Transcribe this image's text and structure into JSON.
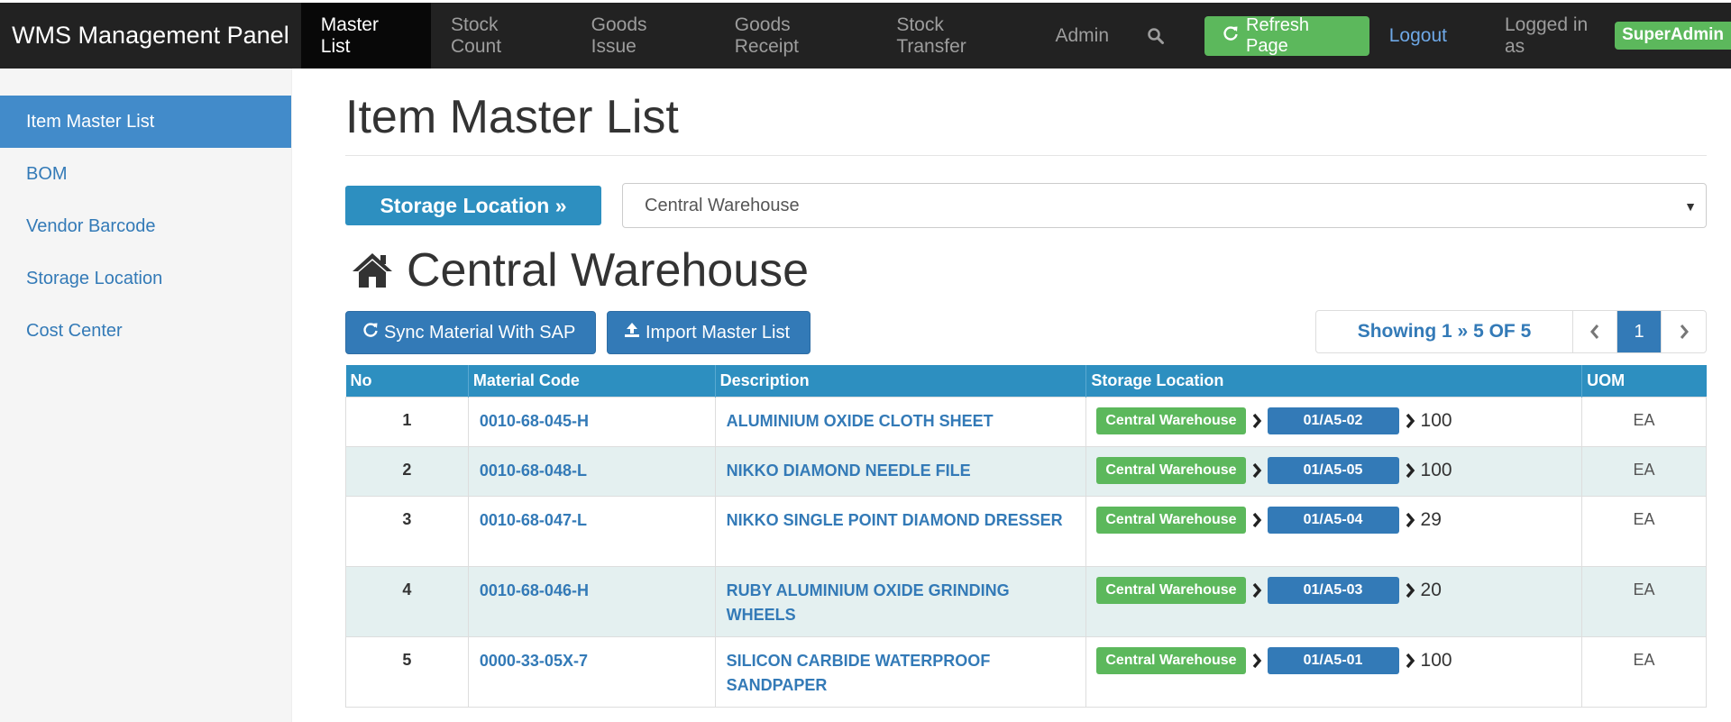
{
  "navbar": {
    "brand": "WMS Management Panel",
    "items": [
      {
        "label": "Master List",
        "active": true
      },
      {
        "label": "Stock Count"
      },
      {
        "label": "Goods Issue"
      },
      {
        "label": "Goods Receipt"
      },
      {
        "label": "Stock Transfer"
      },
      {
        "label": "Admin"
      }
    ],
    "search_icon": "search-icon",
    "refresh_label": "Refresh Page",
    "refresh_icon": "refresh-icon",
    "logout_label": "Logout",
    "logged_in_label": "Logged in as",
    "user": "SuperAdmin"
  },
  "sidebar": {
    "items": [
      {
        "label": "Item Master List",
        "active": true
      },
      {
        "label": "BOM"
      },
      {
        "label": "Vendor Barcode"
      },
      {
        "label": "Storage Location"
      },
      {
        "label": "Cost Center"
      }
    ]
  },
  "main": {
    "title": "Item Master List",
    "storage_button": "Storage Location »",
    "storage_select_value": "Central Warehouse",
    "warehouse_title": "Central Warehouse",
    "warehouse_icon": "home-icon",
    "sync_button": "Sync Material With SAP",
    "import_button": "Import Master List",
    "pager": {
      "showing": "Showing 1 » 5 OF 5",
      "current_page": "1"
    }
  },
  "table": {
    "headers": [
      "No",
      "Material Code",
      "Description",
      "Storage Location",
      "UOM"
    ],
    "rows": [
      {
        "no": "1",
        "code": "0010-68-045-H",
        "desc": "ALUMINIUM OXIDE CLOTH SHEET",
        "warehouse": "Central Warehouse",
        "bin": "01/A5-02",
        "qty": "100",
        "uom": "EA"
      },
      {
        "no": "2",
        "code": "0010-68-048-L",
        "desc": "NIKKO DIAMOND NEEDLE FILE",
        "warehouse": "Central Warehouse",
        "bin": "01/A5-05",
        "qty": "100",
        "uom": "EA"
      },
      {
        "no": "3",
        "code": "0010-68-047-L",
        "desc": "NIKKO SINGLE POINT DIAMOND DRESSER",
        "warehouse": "Central Warehouse",
        "bin": "01/A5-04",
        "qty": "29",
        "uom": "EA"
      },
      {
        "no": "4",
        "code": "0010-68-046-H",
        "desc": "RUBY ALUMINIUM OXIDE GRINDING WHEELS",
        "warehouse": "Central Warehouse",
        "bin": "01/A5-03",
        "qty": "20",
        "uom": "EA"
      },
      {
        "no": "5",
        "code": "0000-33-05X-7",
        "desc": "SILICON CARBIDE WATERPROOF SANDPAPER",
        "warehouse": "Central Warehouse",
        "bin": "01/A5-01",
        "qty": "100",
        "uom": "EA"
      }
    ]
  },
  "colors": {
    "navbar": "#222222",
    "primary": "#337ab7",
    "accent": "#2d8fc0",
    "success": "#5cb85c",
    "row_alt": "#e4f0f0"
  }
}
